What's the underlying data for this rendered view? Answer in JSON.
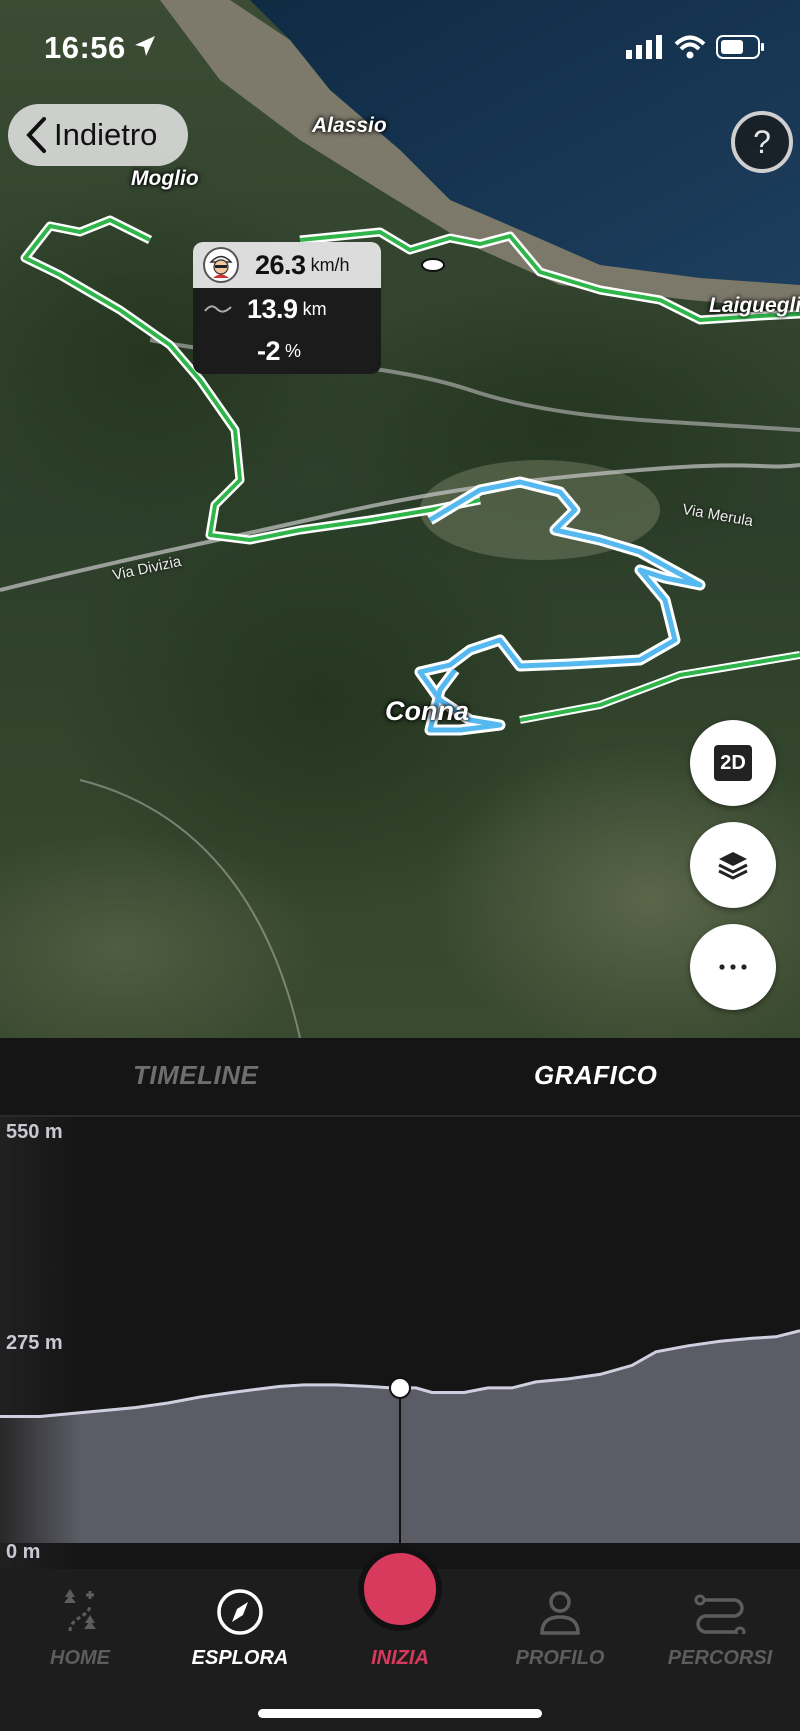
{
  "status_bar": {
    "time": "16:56"
  },
  "header": {
    "back_label": "Indietro",
    "help_label": "?"
  },
  "map": {
    "places": [
      "Alassio",
      "Moglio",
      "Laigueglia",
      "Conna"
    ],
    "roads": [
      "Via Divizia",
      "Via Merula"
    ],
    "info_card": {
      "speed_value": "26.3",
      "speed_unit": "km/h",
      "distance_value": "13.9",
      "distance_unit": "km",
      "grade_value": "-2",
      "grade_unit": "%"
    },
    "controls": {
      "view_mode_label": "2D",
      "layers_icon": "layers-icon",
      "more_icon": "more-dots-icon"
    }
  },
  "tabs": {
    "timeline": "TIMELINE",
    "chart": "GRAFICO",
    "active": "GRAFICO"
  },
  "chart_data": {
    "type": "area",
    "title": "",
    "xlabel": "",
    "ylabel": "",
    "y_ticks": [
      "550 m",
      "275 m",
      "0 m"
    ],
    "ylim": [
      0,
      550
    ],
    "y": [
      168,
      168,
      172,
      176,
      180,
      186,
      194,
      200,
      204,
      208,
      210,
      210,
      208,
      206,
      206,
      200,
      200,
      206,
      206,
      214,
      218,
      224,
      236,
      254,
      262,
      268,
      272,
      274,
      282
    ],
    "x_fraction": [
      0.0,
      0.05,
      0.09,
      0.13,
      0.17,
      0.21,
      0.25,
      0.29,
      0.32,
      0.35,
      0.38,
      0.42,
      0.46,
      0.49,
      0.52,
      0.54,
      0.58,
      0.61,
      0.64,
      0.67,
      0.71,
      0.75,
      0.79,
      0.82,
      0.86,
      0.9,
      0.94,
      0.97,
      1.0
    ],
    "cursor_fraction": 0.5,
    "fill_color": "#5c5c66",
    "line_color": "#cfcfe0",
    "grid": false
  },
  "nav": {
    "items": [
      {
        "label": "HOME",
        "icon": "route-trees-icon"
      },
      {
        "label": "ESPLORA",
        "icon": "compass-icon"
      },
      {
        "label": "INIZIA",
        "icon": "start-record-icon"
      },
      {
        "label": "PROFILO",
        "icon": "person-icon"
      },
      {
        "label": "PERCORSI",
        "icon": "routes-icon"
      }
    ],
    "active": "ESPLORA",
    "accent": "#d83a5e"
  }
}
